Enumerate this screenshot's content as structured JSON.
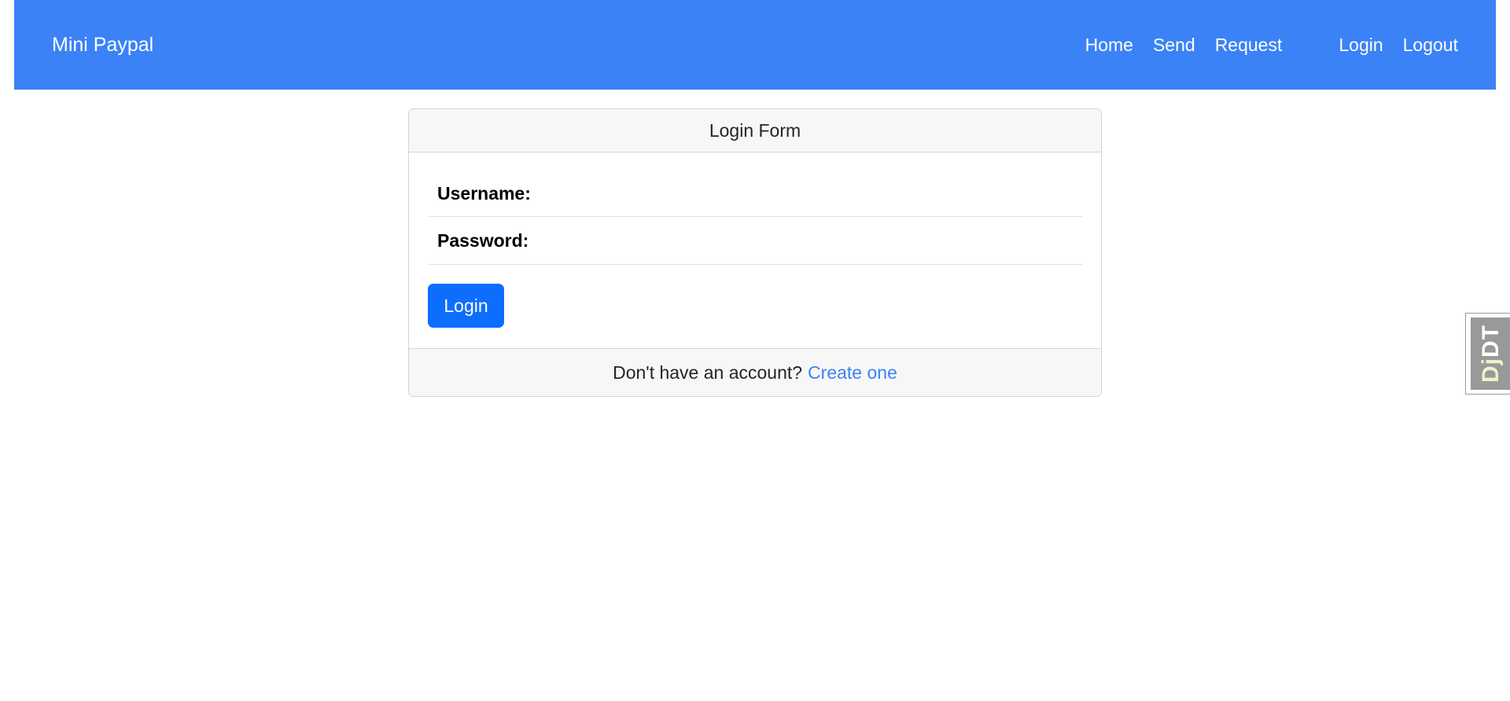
{
  "navbar": {
    "brand": "Mini Paypal",
    "links": [
      "Home",
      "Send",
      "Request"
    ],
    "auth_links": [
      "Login",
      "Logout"
    ],
    "background_color": "#3b82f6"
  },
  "login_card": {
    "header": "Login Form",
    "fields": [
      {
        "label": "Username:",
        "value": ""
      },
      {
        "label": "Password:",
        "value": ""
      }
    ],
    "submit_label": "Login",
    "footer_text": "Don't have an account?",
    "footer_link": "Create one"
  },
  "debug_toolbar": {
    "prefix": "Dj",
    "suffix": "DT"
  },
  "colors": {
    "primary_button": "#0d6efd",
    "link": "#3b82f6"
  }
}
